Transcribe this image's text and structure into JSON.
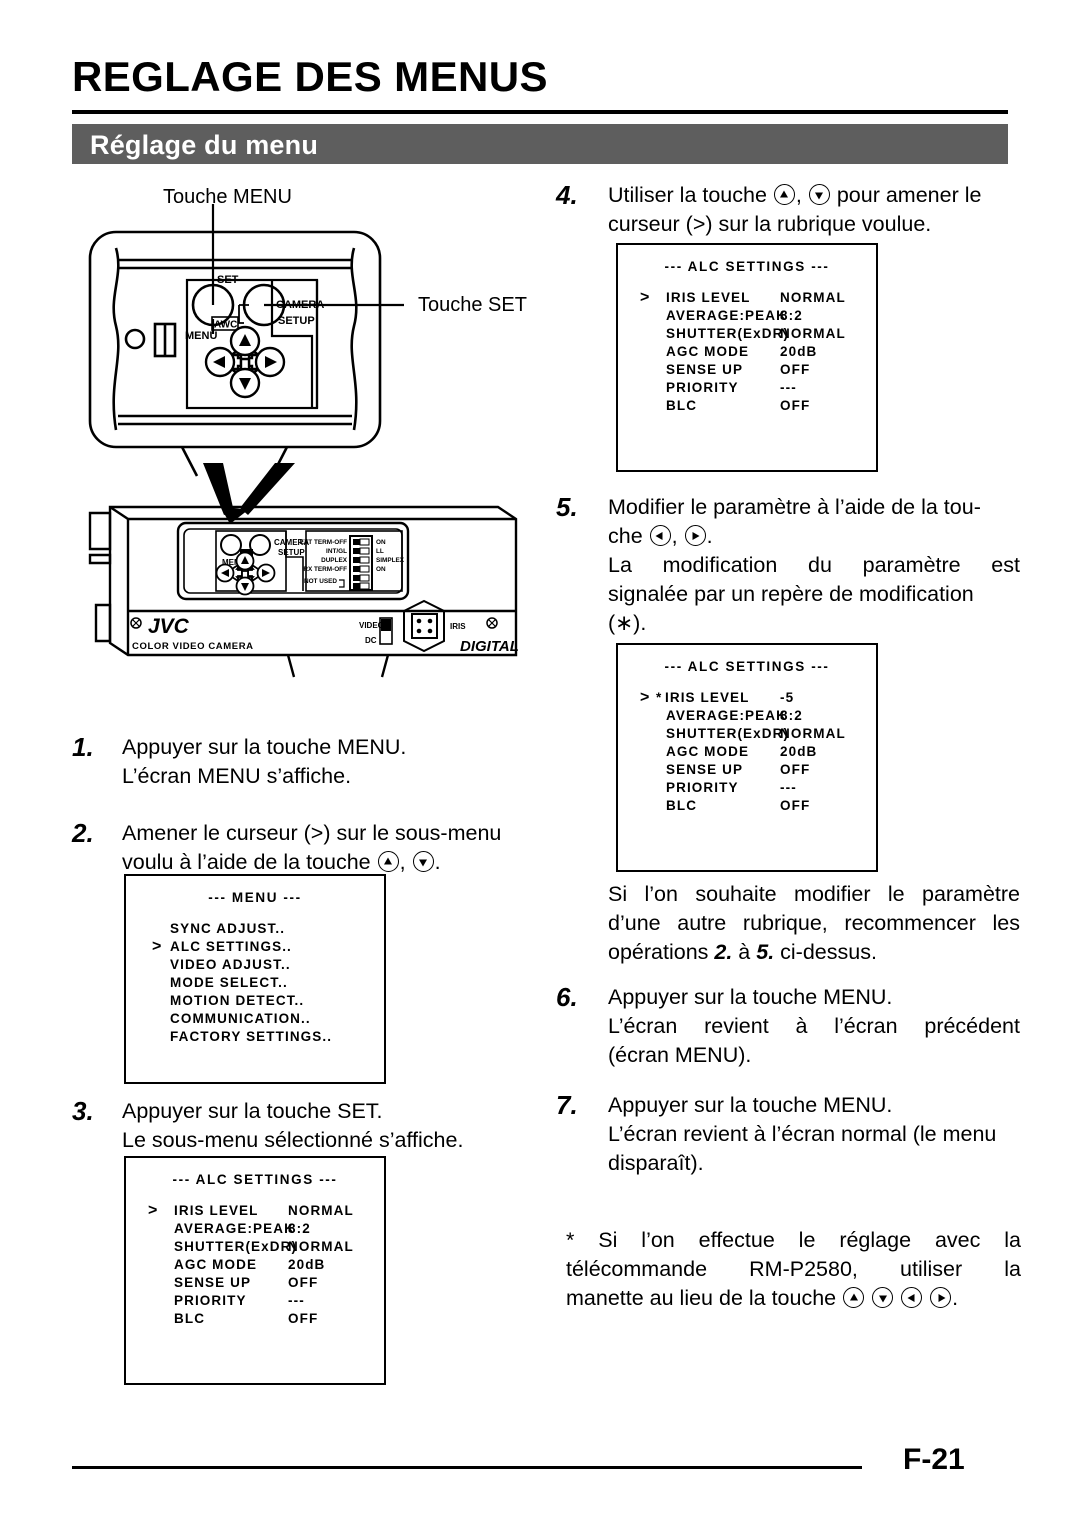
{
  "header": {
    "title": "REGLAGE DES MENUS",
    "section": "Réglage du menu"
  },
  "diagram": {
    "callout_menu": "Touche MENU",
    "callout_set": "Touche SET",
    "panel_labels": {
      "set": "SET",
      "awc": "AWC",
      "menu": "MENU",
      "camera": "CAMERA",
      "setup": "SETUP"
    },
    "body_labels": {
      "camera": "CAMERA",
      "setup": "SETUP",
      "menu": "MENU",
      "brand": "JVC",
      "brand_sub": "COLOR  VIDEO  CAMERA",
      "digital": "DIGITAL",
      "video": "VIDEO",
      "dc": "DC",
      "iris": "IRIS"
    },
    "dip_switch": {
      "left": [
        "EXT TERM-OFF",
        "INT/GL",
        "DUPLEX",
        "RX TERM-OFF",
        "NOT USED"
      ],
      "right": [
        "ON",
        "LL",
        "SIMPLEX",
        "ON"
      ]
    }
  },
  "steps_left": [
    {
      "num": "1.",
      "lines": [
        "Appuyer sur la touche MENU.",
        "L’écran MENU s’affiche."
      ]
    },
    {
      "num": "2.",
      "line1": "Amener le curseur (&gt;) sur le sous-menu",
      "line2_pre": "voulu à l’aide de la touche ",
      "line2_post": "."
    },
    {
      "num": "3.",
      "lines": [
        "Appuyer sur la touche SET.",
        "Le sous-menu sélectionné s’affiche."
      ]
    }
  ],
  "steps_right": [
    {
      "num": "4.",
      "line1_pre": "Utiliser la touche ",
      "line1_post": " pour amener le",
      "line2": "curseur (&gt;) sur la rubrique voulue."
    },
    {
      "num": "5.",
      "line1": "Modifier le paramètre à l’aide de la tou-",
      "line2_pre": "che ",
      "line2_post": ".",
      "line3": "La modification du paramètre est",
      "line4": "signalée par un repère de modification",
      "line5": "(∗)."
    },
    {
      "num": "6.",
      "lines": [
        "Appuyer sur la touche MENU.",
        "L’écran revient à l’écran précédent",
        "(écran MENU)."
      ]
    },
    {
      "num": "7.",
      "lines": [
        "Appuyer sur la touche MENU.",
        "L’écran revient à l’écran normal (le menu",
        "disparaît)."
      ]
    }
  ],
  "note_repeat": {
    "line1": "Si l’on souhaite modifier le paramètre",
    "line2": "d’une autre rubrique, recommencer les",
    "line3_pre": "opérations ",
    "line3_a": "2.",
    "line3_mid": " à ",
    "line3_b": "5.",
    "line3_post": " ci-dessus."
  },
  "note_remote": {
    "line1": "* Si l’on effectue le réglage avec la",
    "line2": "télécommande RM-P2580, utiliser la",
    "line3_pre": "manette au lieu de la touche ",
    "line3_post": "."
  },
  "osd_menu": {
    "title": "--- MENU ---",
    "cursor_index": 1,
    "items": [
      "SYNC ADJUST..",
      "ALC SETTINGS..",
      "VIDEO ADJUST..",
      "MODE SELECT..",
      "MOTION DETECT..",
      "COMMUNICATION..",
      "FACTORY SETTINGS.."
    ]
  },
  "osd_alc": {
    "title": "--- ALC SETTINGS ---",
    "cursor_index": 0,
    "rows": [
      {
        "label": "IRIS LEVEL",
        "value": "NORMAL",
        "marked": false
      },
      {
        "label": "AVERAGE:PEAK",
        "value": "8:2",
        "marked": false
      },
      {
        "label": "SHUTTER(ExDR)",
        "value": "NORMAL",
        "marked": false
      },
      {
        "label": "AGC MODE",
        "value": "20dB",
        "marked": false
      },
      {
        "label": "SENSE UP",
        "value": "OFF",
        "marked": false
      },
      {
        "label": "PRIORITY",
        "value": "---",
        "marked": false
      },
      {
        "label": "BLC",
        "value": "OFF",
        "marked": false
      }
    ]
  },
  "osd_alc_modified": {
    "title": "--- ALC SETTINGS ---",
    "cursor_index": 0,
    "rows": [
      {
        "label": "IRIS LEVEL",
        "value": "-5",
        "marked": true
      },
      {
        "label": "AVERAGE:PEAK",
        "value": "8:2",
        "marked": false
      },
      {
        "label": "SHUTTER(ExDR)",
        "value": "NORMAL",
        "marked": false
      },
      {
        "label": "AGC MODE",
        "value": "20dB",
        "marked": false
      },
      {
        "label": "SENSE UP",
        "value": "OFF",
        "marked": false
      },
      {
        "label": "PRIORITY",
        "value": "---",
        "marked": false
      },
      {
        "label": "BLC",
        "value": "OFF",
        "marked": false
      }
    ]
  },
  "footer": {
    "page": "F-21"
  },
  "colors": {
    "band": "#5e5e5e",
    "ink": "#000000",
    "paper": "#ffffff"
  }
}
